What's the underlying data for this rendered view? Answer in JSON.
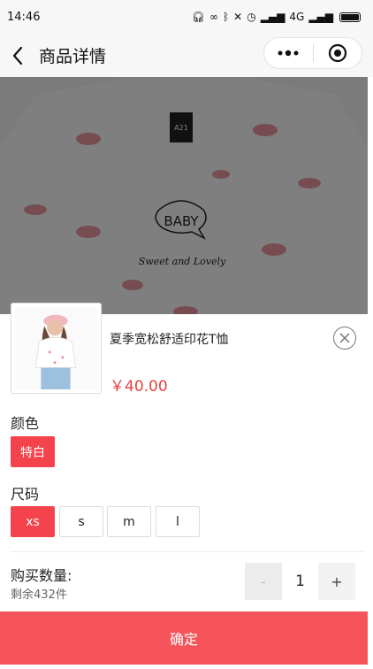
{
  "status_bar": {
    "time": "14:46",
    "network": "4G"
  },
  "nav": {
    "title": "商品详情"
  },
  "hero": {
    "tshirt_text": "BABY",
    "tshirt_script": "Sweet and Lovely",
    "tag_text": "A21"
  },
  "product": {
    "name": "夏季宽松舒适印花T恤",
    "price": "￥40.00"
  },
  "color_section": {
    "label": "颜色",
    "options": [
      "特白"
    ],
    "selected": "特白"
  },
  "size_section": {
    "label": "尺码",
    "options": [
      "xs",
      "s",
      "m",
      "l"
    ],
    "selected": "xs"
  },
  "quantity": {
    "label": "购买数量:",
    "stock": "剩余432件",
    "minus_label": "-",
    "value": "1",
    "plus_label": "+"
  },
  "confirm": {
    "label": "确定"
  },
  "colors": {
    "accent": "#f4434c",
    "price": "#e64340",
    "confirm_bg": "#f4545a"
  }
}
